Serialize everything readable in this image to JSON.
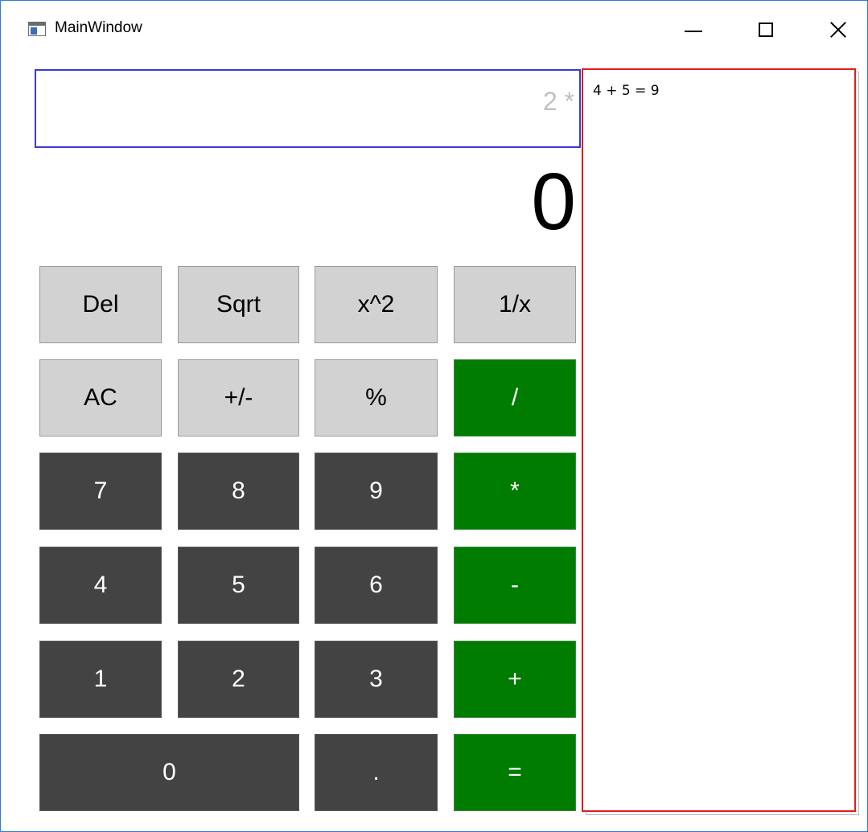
{
  "window": {
    "title": "MainWindow"
  },
  "display": {
    "expression": "2 *",
    "result": "0"
  },
  "keypad": {
    "row1": [
      "Del",
      "Sqrt",
      "x^2",
      "1/x"
    ],
    "row2": [
      "AC",
      "+/-",
      "%",
      "/"
    ],
    "row3": [
      "7",
      "8",
      "9",
      "*"
    ],
    "row4": [
      "4",
      "5",
      "6",
      "-"
    ],
    "row5": [
      "1",
      "2",
      "3",
      "+"
    ],
    "row6": [
      "0",
      ".",
      "="
    ]
  },
  "history": {
    "entries": [
      "4 + 5 = 9"
    ]
  },
  "colors": {
    "function_key": "#d2d2d2",
    "digit_key": "#434343",
    "operator_key": "#007c00",
    "expression_border": "#3a3ad9",
    "history_border": "#e01c1c"
  }
}
